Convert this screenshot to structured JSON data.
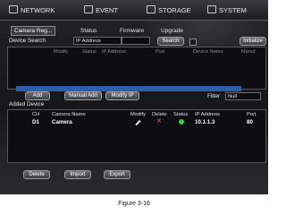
{
  "topnav": {
    "network": {
      "label": "NETWORK",
      "icon": "network-icon"
    },
    "event": {
      "label": "EVENT",
      "icon": "event-icon"
    },
    "storage": {
      "label": "STORAGE",
      "icon": "storage-icon"
    },
    "system": {
      "label": "SYSTEM",
      "icon": "system-icon"
    }
  },
  "subtabs": [
    "Camera Reg...",
    "Status",
    "Firmware",
    "Upgrade"
  ],
  "search": {
    "label": "Device Search",
    "mode": "IP Address",
    "search_button": "Search",
    "init_button": "Initialize"
  },
  "device_table": {
    "headers": [
      "Modify",
      "Status",
      "IP Address",
      "Port",
      "Device Name",
      "Manuf"
    ]
  },
  "actions": {
    "add": "Add",
    "manual_add": "Manual Add",
    "modify_ip": "Modify IP"
  },
  "filter": {
    "label": "Filter",
    "value": "Null"
  },
  "added": {
    "title": "Added Device",
    "headers": [
      "CH",
      "Camera Name",
      "Modify",
      "Delete",
      "Status",
      "IP Address",
      "Port"
    ],
    "rows": [
      {
        "ch": "D1",
        "name": "Camera",
        "ip": "10.1.1.3",
        "port": "80",
        "status_color": "#33cc44"
      }
    ]
  },
  "bottom": {
    "delete": "Delete",
    "import": "Import",
    "export": "Export"
  },
  "caption": "Figure 3-16"
}
